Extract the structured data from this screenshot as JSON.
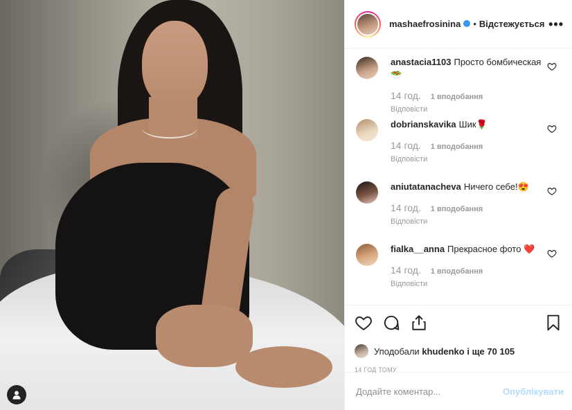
{
  "post": {
    "username": "mashaefrosinina",
    "separator": "•",
    "follow_status": "Відстежується",
    "more_label": "•••",
    "comments": [
      {
        "user": "anastacia1103",
        "text": "Просто бомбическая 🥗",
        "time": "14 год.",
        "likes": "1 вподобання",
        "reply": "Відповісти"
      },
      {
        "user": "dobrianskavika",
        "text": "Шик🌹",
        "time": "14 год.",
        "likes": "1 вподобання",
        "reply": "Відповісти"
      },
      {
        "user": "aniutatanacheva",
        "text": "Ничего себе!😍",
        "time": "14 год.",
        "likes": "1 вподобання",
        "reply": "Відповісти"
      },
      {
        "user": "fialka__anna",
        "text": "Прекрасное фото ❤️",
        "time": "14 год.",
        "likes": "1 вподобання",
        "reply": "Відповісти"
      }
    ],
    "liked_by_prefix": "Уподобали",
    "liked_by_user": "khudenko",
    "liked_by_rest": "і ще 70 105",
    "time_ago": "14 ГОД ТОМУ",
    "comment_placeholder": "Додайте коментар...",
    "publish_label": "Опублікувати"
  },
  "colors": {
    "verified": "#3897f0",
    "publish_disabled": "#b3dbff",
    "muted": "#999999"
  },
  "icons": [
    "user-tag-icon",
    "verified-icon",
    "more-icon",
    "heart-icon",
    "comment-icon",
    "share-icon",
    "bookmark-icon"
  ]
}
